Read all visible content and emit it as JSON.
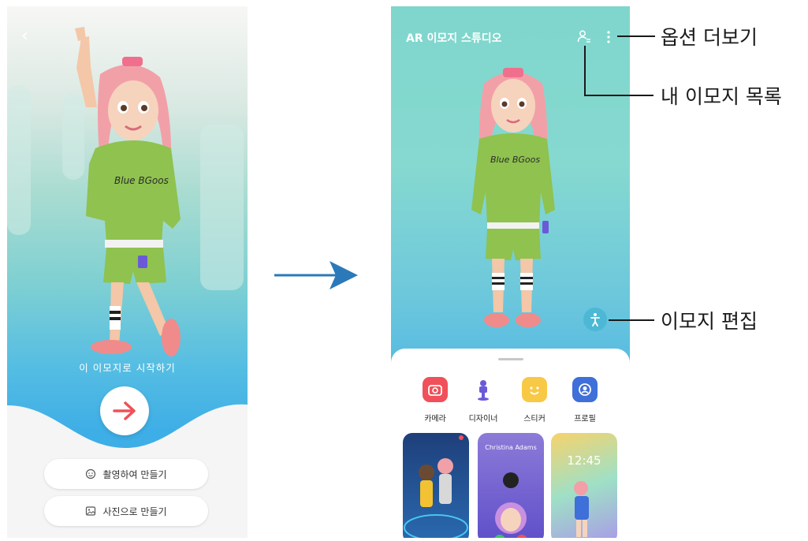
{
  "left_screen": {
    "start_label": "이 이모지로 시작하기",
    "capture_button_label": "촬영하여 만들기",
    "photo_button_label": "사진으로 만들기",
    "back_icon": "chevron-left-icon",
    "start_icon": "arrow-right-icon"
  },
  "right_screen": {
    "title": "AR 이모지 스튜디오",
    "header_icons": [
      "my-emoji-list-icon",
      "more-options-icon"
    ],
    "menu": [
      {
        "label": "카메라",
        "icon": "camera-icon",
        "color": "#f0505a"
      },
      {
        "label": "디자이너",
        "icon": "designer-icon",
        "color": "#6a5ad8"
      },
      {
        "label": "스티커",
        "icon": "sticker-icon",
        "color": "#f7c945"
      },
      {
        "label": "프로필",
        "icon": "profile-icon",
        "color": "#3f6fd9"
      }
    ],
    "cards": [
      {
        "caption": ""
      },
      {
        "caption": "Christina Adams"
      },
      {
        "caption": "12:45"
      }
    ]
  },
  "callouts": {
    "more_options": "옵션 더보기",
    "my_emoji_list": "내 이모지 목록",
    "edit_emoji": "이모지 편집"
  },
  "colors": {
    "accent_red": "#f0505a",
    "flow_arrow": "#2b79b8",
    "edit_button": "#4cb8d6"
  }
}
